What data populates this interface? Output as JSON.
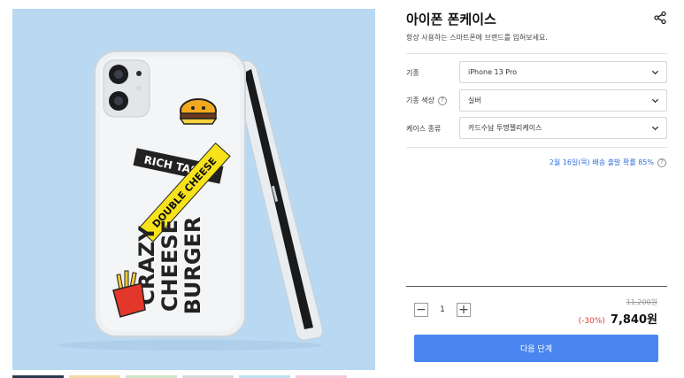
{
  "product": {
    "title": "아이폰 폰케이스",
    "subtitle": "항상 사용하는 스마트폰에 브랜드를 입혀보세요."
  },
  "hero_image": {
    "background": "#b9d9f2",
    "stickers": {
      "rich_taste": "RICH TASTE",
      "double_cheese": "DOUBLE CHEESE",
      "crazy": "CRAZY",
      "cheese": "CHEESE",
      "burger": "BURGER"
    }
  },
  "thumbnails": [
    {
      "color": "#2d3a4d"
    },
    {
      "color": "#f2dba6"
    },
    {
      "color": "#cfe3c9"
    },
    {
      "color": "#d9d9d9"
    },
    {
      "color": "#bfe0f3"
    },
    {
      "color": "#f5c9d6"
    }
  ],
  "options": [
    {
      "label": "기종",
      "value": "iPhone 13 Pro",
      "help": false
    },
    {
      "label": "기종 색상",
      "value": "실버",
      "help": true
    },
    {
      "label": "케이스 종류",
      "value": "카드수납 투명젤리케이스",
      "help": false
    }
  ],
  "help_glyph": "?",
  "delivery": {
    "text": "2월 16일(목) 배송 출발 확률 85%"
  },
  "purchase": {
    "quantity": "1",
    "minus": "−",
    "plus": "+",
    "original_price": "11,200원",
    "discount": "(-30%)",
    "sale_price": "7,840원",
    "next_label": "다음 단계"
  },
  "colors": {
    "accent": "#4a86ef",
    "discount": "#e33b2f",
    "delivery": "#2f6fe0"
  }
}
